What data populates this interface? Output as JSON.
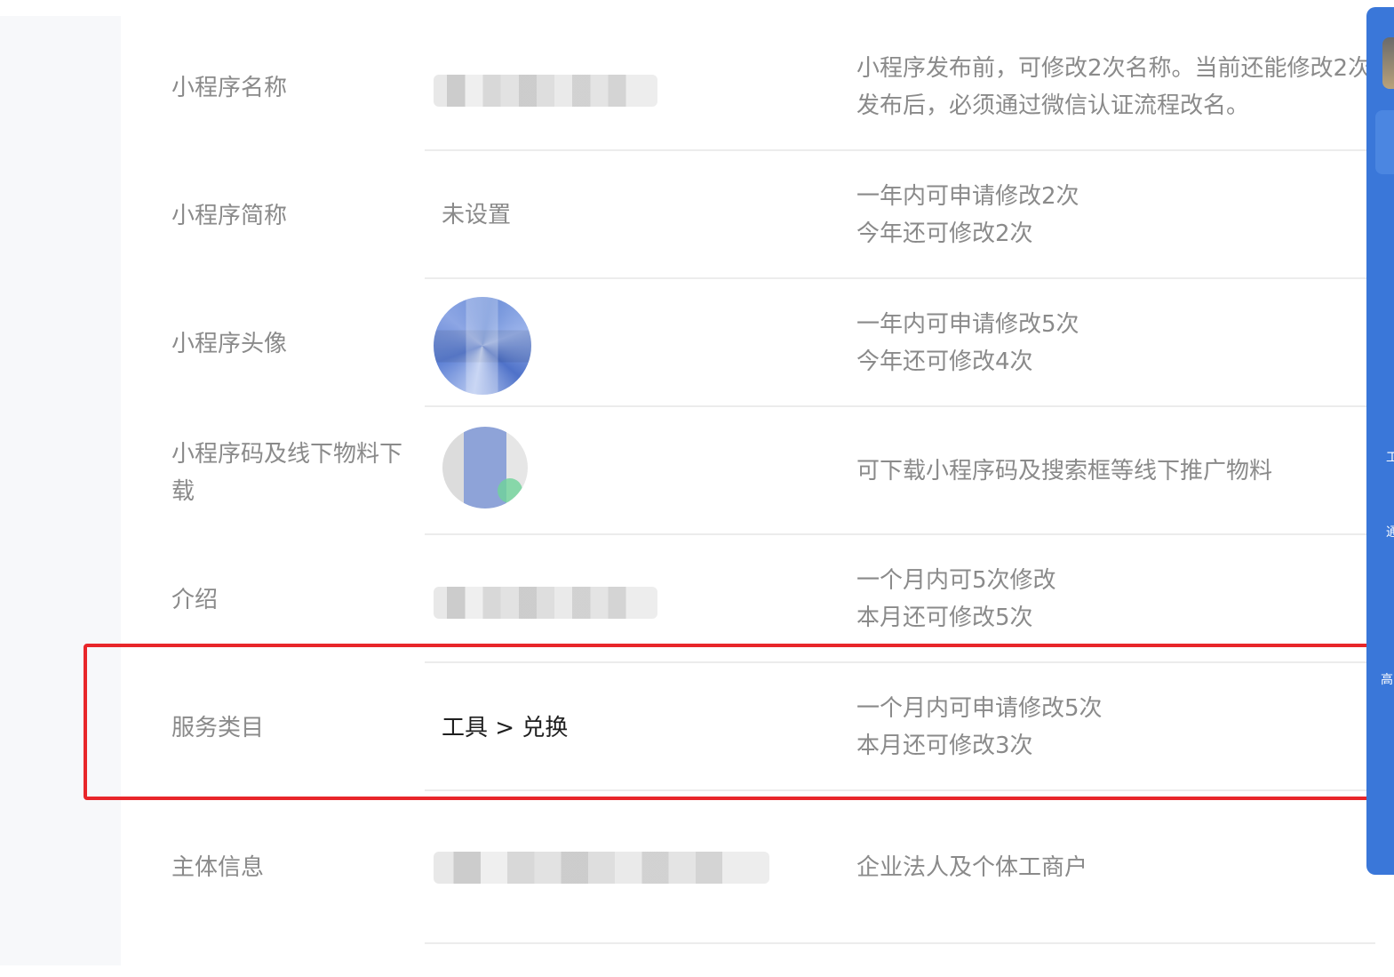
{
  "rows": [
    {
      "label": "小程序名称",
      "value": "",
      "desc_line1": "小程序发布前，可修改2次名称。当前还能修改2次",
      "desc_line2": "发布后，必须通过微信认证流程改名。"
    },
    {
      "label": "小程序简称",
      "value": "未设置",
      "desc_line1": "一年内可申请修改2次",
      "desc_line2": "今年还可修改2次"
    },
    {
      "label": "小程序头像",
      "value": "",
      "desc_line1": "一年内可申请修改5次",
      "desc_line2": "今年还可修改4次"
    },
    {
      "label_line1": "小程序码及线下物料下",
      "label_line2": "载",
      "value": "",
      "desc_line1": "可下载小程序码及搜索框等线下推广物料"
    },
    {
      "label": "介绍",
      "value": "",
      "desc_line1": "一个月内可5次修改",
      "desc_line2": "本月还可修改5次"
    },
    {
      "label": "服务类目",
      "value": "工具 > 兑换",
      "desc_line1": "一个月内可申请修改5次",
      "desc_line2": "本月还可修改3次"
    },
    {
      "label": "主体信息",
      "value": "",
      "desc_line1": "企业法人及个体工商户"
    }
  ],
  "right_panel": {
    "text_1": "工",
    "text_2": "通",
    "text_3": "高"
  },
  "colors": {
    "highlight": "#e8262a",
    "panel": "#3a77d9",
    "label": "#8a8a8a",
    "value_dark": "#1f1f1f"
  }
}
